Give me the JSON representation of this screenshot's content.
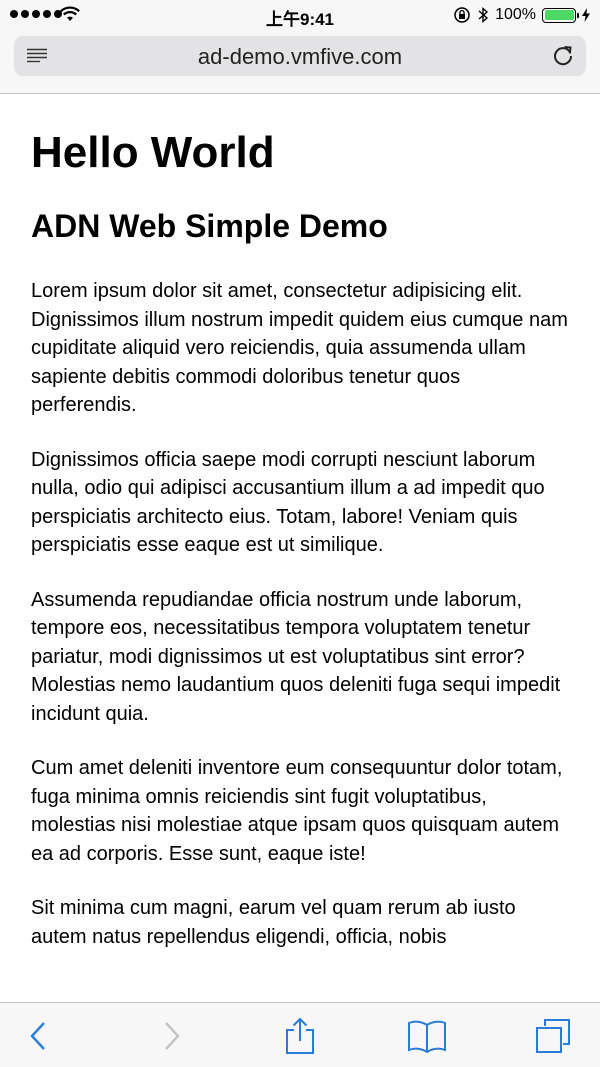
{
  "status_bar": {
    "time": "上午9:41",
    "battery_percent": "100%",
    "battery_level": 1.0,
    "signal_bars": 5,
    "icons": [
      "signal-icon",
      "wifi-icon",
      "orientation-lock-icon",
      "bluetooth-icon",
      "battery-icon",
      "charging-icon"
    ]
  },
  "address_bar": {
    "url": "ad-demo.vmfive.com",
    "icons": [
      "reader-icon",
      "reload-icon"
    ]
  },
  "page": {
    "heading": "Hello World",
    "subheading": "ADN Web Simple Demo",
    "paragraphs": [
      "Lorem ipsum dolor sit amet, consectetur adipisicing elit. Dignissimos illum nostrum impedit quidem eius cumque nam cupiditate aliquid vero reiciendis, quia assumenda ullam sapiente debitis commodi doloribus tenetur quos perferendis.",
      "Dignissimos officia saepe modi corrupti nesciunt laborum nulla, odio qui adipisci accusantium illum a ad impedit quo perspiciatis architecto eius. Totam, labore! Veniam quis perspiciatis esse eaque est ut similique.",
      "Assumenda repudiandae officia nostrum unde laborum, tempore eos, necessitatibus tempora voluptatem tenetur pariatur, modi dignissimos ut est voluptatibus sint error? Molestias nemo laudantium quos deleniti fuga sequi impedit incidunt quia.",
      "Cum amet deleniti inventore eum consequuntur dolor totam, fuga minima omnis reiciendis sint fugit voluptatibus, molestias nisi molestiae atque ipsam quos quisquam autem ea ad corporis. Esse sunt, eaque iste!",
      "Sit minima cum magni, earum vel quam rerum ab iusto autem natus repellendus eligendi, officia, nobis"
    ]
  },
  "toolbar": {
    "icons": [
      "back-icon",
      "forward-icon",
      "share-icon",
      "bookmarks-icon",
      "tabs-icon"
    ],
    "accent_color": "#2a7cd8",
    "disabled_color": "#c4c4c9"
  }
}
